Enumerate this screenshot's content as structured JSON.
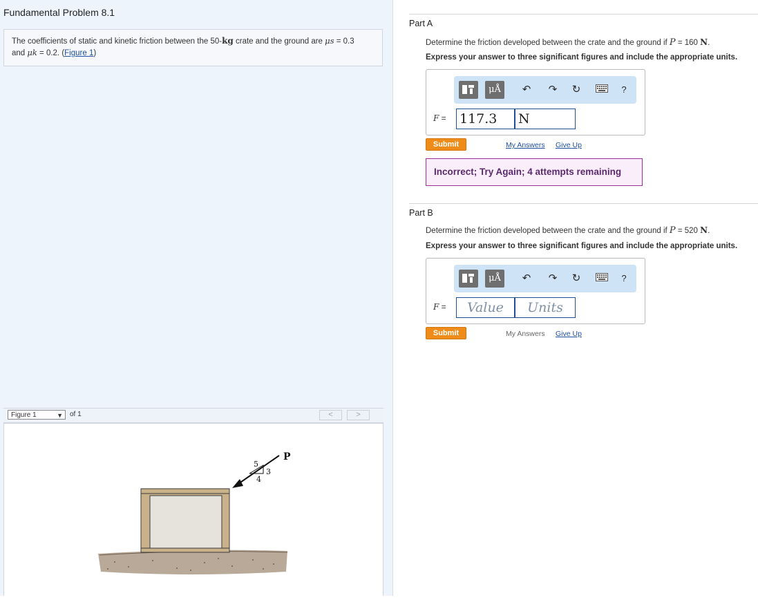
{
  "problem": {
    "title": "Fundamental Problem 8.1",
    "text_before_mass": "The coefficients of static and kinetic friction between the 50-",
    "mass_unit": "kg",
    "text_after_mass": " crate and the ground are ",
    "mu_s_symbol": "μs",
    "mu_s_value": " = 0.3",
    "text_and": "and ",
    "mu_k_symbol": "μk",
    "mu_k_value": " = 0.2. (",
    "figure_link": "Figure 1",
    "text_close": ")"
  },
  "figure_nav": {
    "selected": "Figure 1",
    "of_label": "of 1",
    "prev": "<",
    "next": ">"
  },
  "figure": {
    "force_label": "P",
    "slope_hyp": "5",
    "slope_rise": "3",
    "slope_run": "4"
  },
  "part_a": {
    "title": "Part A",
    "question_prefix": "Determine the friction developed between the crate and the ground if ",
    "question_var": "P",
    "question_value": " = 160 ",
    "question_unit": "N",
    "question_end": ".",
    "instruction": "Express your answer to three significant figures and include the appropriate units.",
    "var_label": "F",
    "equals": " =",
    "value": "117.3",
    "units": "N",
    "submit": "Submit",
    "my_answers": "My Answers",
    "give_up": "Give Up",
    "feedback": "Incorrect; Try Again; 4 attempts remaining"
  },
  "part_b": {
    "title": "Part B",
    "question_prefix": "Determine the friction developed between the crate and the ground if ",
    "question_var": "P",
    "question_value": " = 520 ",
    "question_unit": "N",
    "question_end": ".",
    "instruction": "Express your answer to three significant figures and include the appropriate units.",
    "var_label": "F",
    "equals": " =",
    "value_placeholder": "Value",
    "units_placeholder": "Units",
    "submit": "Submit",
    "my_answers": "My Answers",
    "give_up": "Give Up"
  },
  "toolbar": {
    "units_glyph": "μÅ",
    "help": "?",
    "icons": [
      "templates-icon",
      "units-icon",
      "undo-icon",
      "redo-icon",
      "reset-icon",
      "keyboard-icon",
      "help-icon"
    ]
  },
  "colors": {
    "submit": "#ef8c19",
    "link": "#1f4fa0",
    "feedback_border": "#9b2d9b",
    "feedback_bg": "#fbeefb",
    "toolbar_bg": "#cfe3f6"
  }
}
